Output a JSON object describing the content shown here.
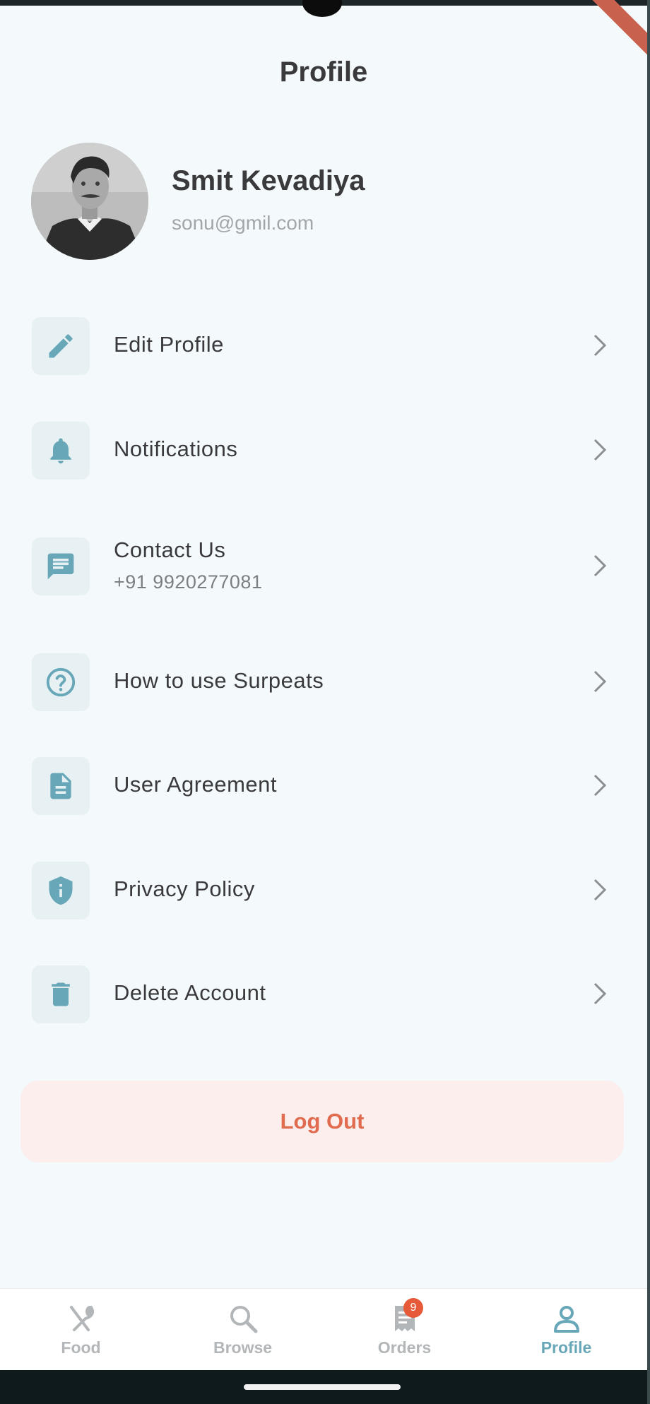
{
  "header": {
    "title": "Profile"
  },
  "user": {
    "name": "Smit Kevadiya",
    "email": "sonu@gmil.com"
  },
  "menu": [
    {
      "label": "Edit Profile",
      "sub": "",
      "icon": "pencil-icon"
    },
    {
      "label": "Notifications",
      "sub": "",
      "icon": "bell-icon"
    },
    {
      "label": "Contact Us",
      "sub": "+91 9920277081",
      "icon": "chat-icon"
    },
    {
      "label": "How to use Surpeats",
      "sub": "",
      "icon": "help-circle-icon"
    },
    {
      "label": "User Agreement",
      "sub": "",
      "icon": "document-icon"
    },
    {
      "label": "Privacy Policy",
      "sub": "",
      "icon": "shield-icon"
    },
    {
      "label": "Delete Account",
      "sub": "",
      "icon": "trash-icon"
    }
  ],
  "logout": {
    "label": "Log Out"
  },
  "bottom_nav": {
    "items": [
      {
        "label": "Food",
        "icon": "utensils-icon",
        "active": false
      },
      {
        "label": "Browse",
        "icon": "search-icon",
        "active": false
      },
      {
        "label": "Orders",
        "icon": "receipt-icon",
        "active": false,
        "badge": "9"
      },
      {
        "label": "Profile",
        "icon": "person-icon",
        "active": true
      }
    ]
  },
  "colors": {
    "background": "#f4f9fb",
    "accent": "#67a7b8",
    "icon_box": "#e7f0f2",
    "logout_text": "#e06b4e",
    "logout_bg": "#fbeeec",
    "badge": "#e65a3a"
  }
}
